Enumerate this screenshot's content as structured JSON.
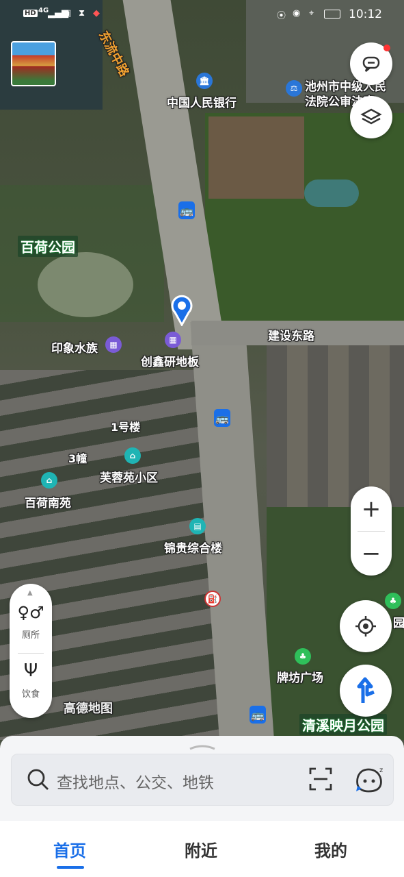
{
  "status_bar": {
    "left_icons": [
      "HD",
      "4G"
    ],
    "time": "10:12"
  },
  "map": {
    "roads": {
      "dongliu": "东流中路",
      "jianshe": "建设东路"
    },
    "parks": {
      "baihe": "百荷公园",
      "qingxi": "清溪映月公园",
      "yuan_partial": "园"
    },
    "pois": {
      "bank": "中国人民银行",
      "court_line1": "池州市中级人民",
      "court_line2": "法院公审法庭",
      "yinxiang": "印象水族",
      "chuangxin": "创鑫研地板",
      "building1": "1号楼",
      "building3": "3幢",
      "furong": "芙蓉苑小区",
      "baihenan": "百荷南苑",
      "jingui": "锦贵综合楼",
      "paifang": "牌坊广场"
    },
    "watermark": "高德地图"
  },
  "left_panel": {
    "toilet": "厕所",
    "food": "饮食"
  },
  "search": {
    "placeholder": "查找地点、公交、地铁"
  },
  "tabs": [
    {
      "label": "首页",
      "active": true
    },
    {
      "label": "附近",
      "active": false
    },
    {
      "label": "我的",
      "active": false
    }
  ],
  "colors": {
    "accent": "#1a6fe8",
    "bus": "#1a6fe8",
    "poi_purple": "#7a5bd6",
    "poi_teal": "#1fb4b4",
    "poi_green": "#2fbf5a"
  }
}
